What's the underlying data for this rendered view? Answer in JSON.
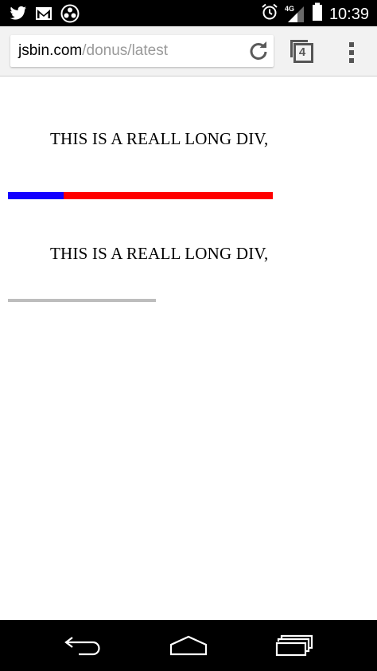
{
  "status_bar": {
    "time": "10:39",
    "network": "4G",
    "left_icons": [
      "twitter-icon",
      "gmail-icon",
      "app-notification-icon"
    ],
    "right_icons": [
      "alarm-icon",
      "signal-icon",
      "battery-icon"
    ]
  },
  "toolbar": {
    "url_host": "jsbin.com",
    "url_path": "/donus/latest",
    "tab_count": "4"
  },
  "page": {
    "text_1": "THIS IS A REALL LONG DIV,",
    "text_2": "THIS IS A REALL LONG DIV,",
    "progress_1": {
      "fill_percent": 21,
      "fill_color": "#1400ff",
      "rest_color": "#ff0000"
    },
    "progress_2": {
      "color": "#bdbdbd"
    }
  },
  "nav_bar": {
    "icons": [
      "back-icon",
      "home-icon",
      "recent-apps-icon"
    ]
  }
}
